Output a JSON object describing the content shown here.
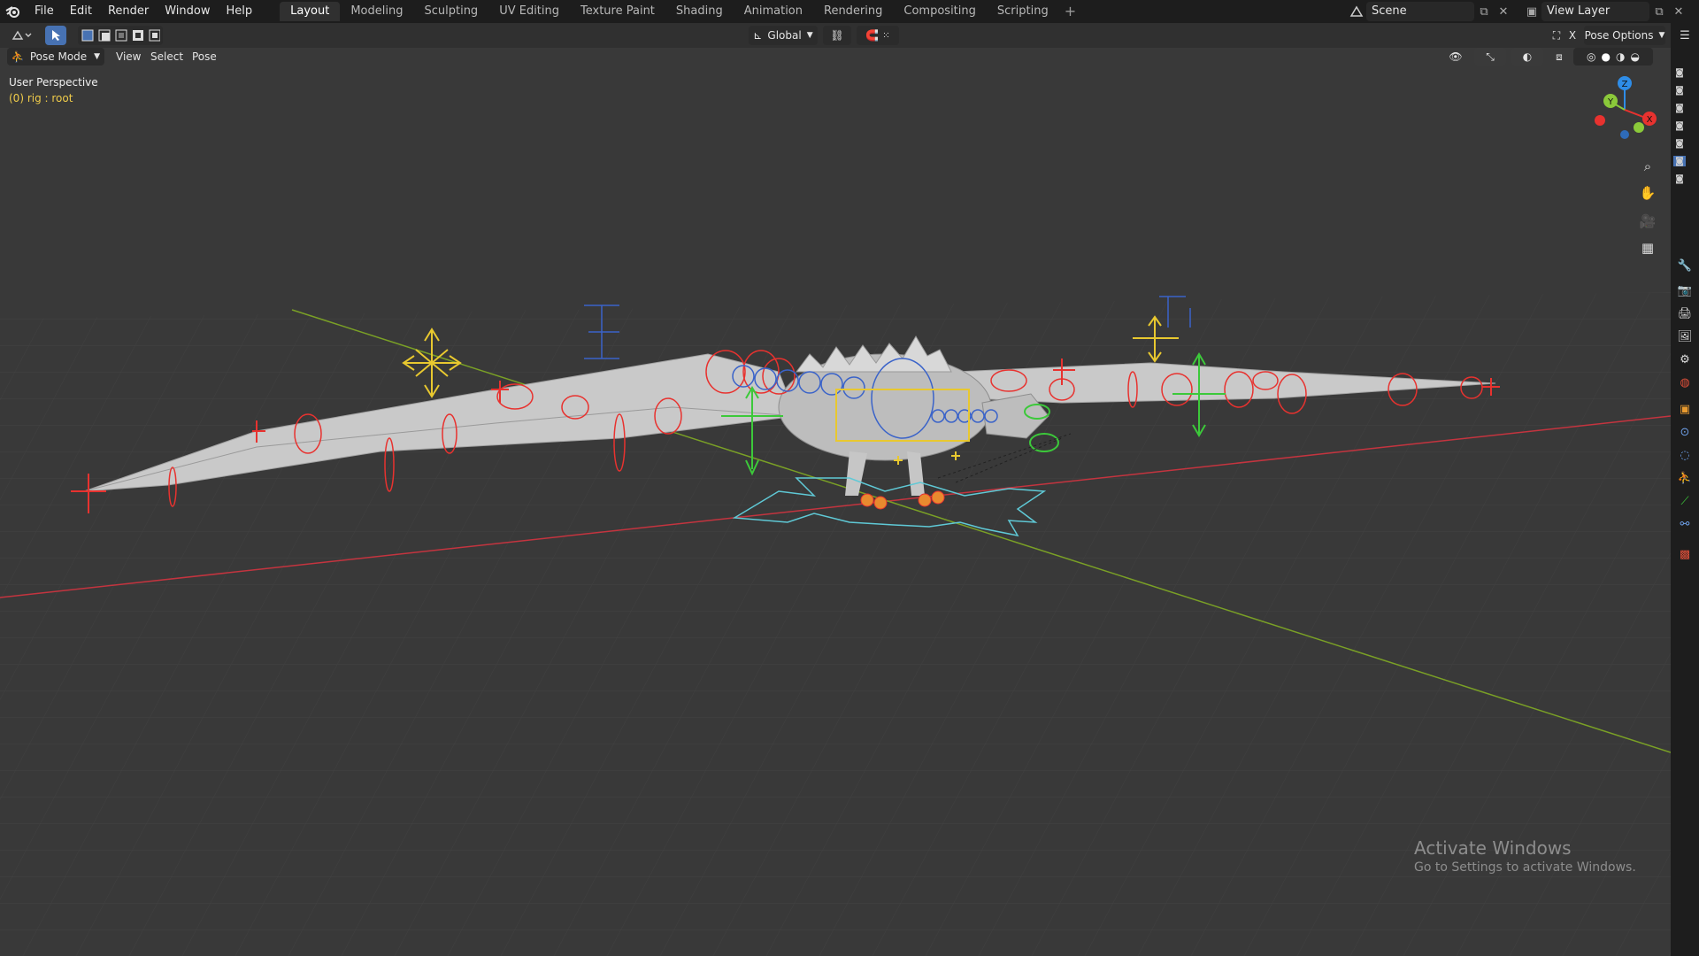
{
  "menu": {
    "items": [
      "File",
      "Edit",
      "Render",
      "Window",
      "Help"
    ]
  },
  "workspaces": {
    "tabs": [
      "Layout",
      "Modeling",
      "Sculpting",
      "UV Editing",
      "Texture Paint",
      "Shading",
      "Animation",
      "Rendering",
      "Compositing",
      "Scripting"
    ],
    "active": "Layout",
    "add": "+"
  },
  "scene": {
    "name": "Scene",
    "view_layer": "View Layer"
  },
  "toolbar": {
    "transform_orientation": "Global",
    "pose_options": "Pose Options",
    "mode": "Pose Mode",
    "view": "View",
    "select": "Select",
    "pose": "Pose"
  },
  "viewport": {
    "perspective_label": "User Perspective",
    "object_label": "(0) rig : root",
    "gizmo": {
      "x": "X",
      "y": "Y",
      "z": "Z"
    }
  },
  "watermark": {
    "title": "Activate Windows",
    "subtitle": "Go to Settings to activate Windows."
  },
  "colors": {
    "accent": "#4772b3",
    "bone_red": "#e8322f",
    "bone_yellow": "#e8c82f",
    "bone_blue": "#3a63c9",
    "bone_green": "#3cc93a",
    "x_axis": "#c4343f",
    "y_axis": "#7aa026"
  }
}
